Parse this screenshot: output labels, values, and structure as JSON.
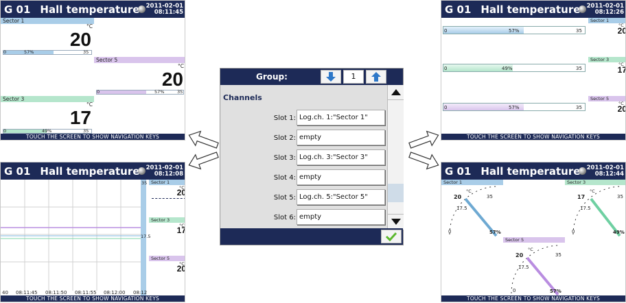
{
  "header_group": "G 01",
  "header_title": "Hall temperature",
  "footer_text": "TOUCH THE SCREEN TO SHOW NAVIGATION KEYS",
  "unit": "°C",
  "colors": {
    "blue": "#a9cde8",
    "purple": "#d9c4ec",
    "green": "#b5e6cc",
    "navy": "#1d2a57"
  },
  "screen_tl": {
    "date": "2011-02-01",
    "time": "08:11:45",
    "cells": [
      {
        "name": "Sector 1",
        "value": "20",
        "min": "0",
        "max": "35",
        "pct": "57%"
      },
      {
        "name": "Sector 5",
        "value": "20",
        "min": "0",
        "max": "35",
        "pct": "57%"
      },
      {
        "name": "Sector 3",
        "value": "17",
        "min": "0",
        "max": "35",
        "pct": "49%"
      }
    ]
  },
  "screen_bl": {
    "date": "2011-02-01",
    "time": "08:12:08",
    "times": [
      "40",
      "08:11:45",
      "08:11:50",
      "08:11:55",
      "08:12:00",
      "08:12"
    ],
    "axis_mid": "17.5",
    "axis_top": "35",
    "cells": [
      {
        "name": "Sector 1",
        "value": "20"
      },
      {
        "name": "Sector 3",
        "value": "17"
      },
      {
        "name": "Sector 5",
        "value": "20"
      }
    ]
  },
  "dialog": {
    "group_label": "Group:",
    "group_value": "1",
    "channels_title": "Channels",
    "slots": [
      {
        "label": "Slot 1:",
        "value": "Log.ch. 1:\"Sector 1\""
      },
      {
        "label": "Slot 2:",
        "value": "empty"
      },
      {
        "label": "Slot 3:",
        "value": "Log.ch. 3:\"Sector 3\""
      },
      {
        "label": "Slot 4:",
        "value": "empty"
      },
      {
        "label": "Slot 5:",
        "value": "Log.ch. 5:\"Sector 5\""
      },
      {
        "label": "Slot 6:",
        "value": "empty"
      }
    ]
  },
  "screen_tr": {
    "date": "2011-02-01",
    "time": "08:12:26",
    "rows": [
      {
        "name": "Sector 1",
        "value": "20",
        "min": "0",
        "max": "35",
        "pct": "57%"
      },
      {
        "name": "Sector 3",
        "value": "17",
        "min": "0",
        "max": "35",
        "pct": "49%"
      },
      {
        "name": "Sector 5",
        "value": "20",
        "min": "0",
        "max": "35",
        "pct": "57%"
      }
    ]
  },
  "screen_br": {
    "date": "2011-02-01",
    "time": "08:12:44",
    "gauges": [
      {
        "name": "Sector 1",
        "value": "20",
        "min": "0",
        "max": "35",
        "mid": "17.5",
        "pct": "57%"
      },
      {
        "name": "Sector 3",
        "value": "17",
        "min": "0",
        "max": "35",
        "mid": "17.5",
        "pct": "49%"
      },
      {
        "name": "Sector 5",
        "value": "20",
        "min": "0",
        "max": "35",
        "mid": "17.5",
        "pct": "57%"
      }
    ]
  }
}
